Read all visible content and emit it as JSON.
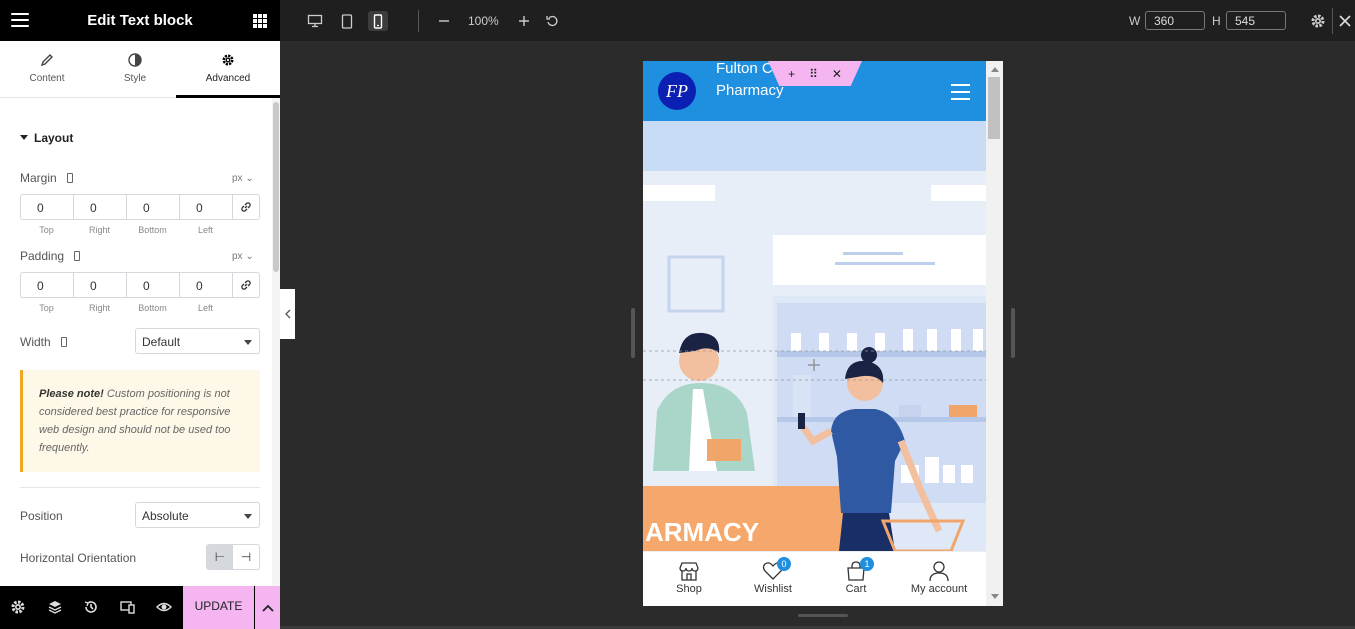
{
  "panel": {
    "title": "Edit Text block",
    "tabs": [
      {
        "label": "Content",
        "icon": "pencil-icon"
      },
      {
        "label": "Style",
        "icon": "half-circle-icon"
      },
      {
        "label": "Advanced",
        "icon": "gear-icon",
        "active": true
      }
    ],
    "section": "Layout",
    "margin": {
      "label": "Margin",
      "unit": "px",
      "values": [
        "0",
        "0",
        "0",
        "0"
      ],
      "sides": [
        "Top",
        "Right",
        "Bottom",
        "Left"
      ]
    },
    "padding": {
      "label": "Padding",
      "unit": "px",
      "values": [
        "0",
        "0",
        "0",
        "0"
      ],
      "sides": [
        "Top",
        "Right",
        "Bottom",
        "Left"
      ]
    },
    "width": {
      "label": "Width",
      "value": "Default"
    },
    "note": {
      "strong": "Please note!",
      "text": " Custom positioning is not considered best practice for responsive web design and should not be used too frequently."
    },
    "position": {
      "label": "Position",
      "value": "Absolute"
    },
    "horizontal_orientation": {
      "label": "Horizontal Orientation"
    },
    "update_label": "UPDATE"
  },
  "toolbar": {
    "zoom": "100%",
    "width_label": "W",
    "width_value": "360",
    "height_label": "H",
    "height_value": "545"
  },
  "preview": {
    "logo_text": "FP",
    "site_name": "Fulton Care Pharmacy",
    "hero_text": "ARMACY",
    "nav": [
      {
        "label": "Shop",
        "icon": "store-icon"
      },
      {
        "label": "Wishlist",
        "icon": "heart-icon",
        "badge": "0"
      },
      {
        "label": "Cart",
        "icon": "bag-icon",
        "badge": "1"
      },
      {
        "label": "My account",
        "icon": "user-icon"
      }
    ]
  },
  "colors": {
    "accent_pink": "#f4b5f0",
    "header_blue": "#1f8fe0",
    "logo_blue": "#0b1fb3",
    "note_border": "#f0a61f"
  }
}
